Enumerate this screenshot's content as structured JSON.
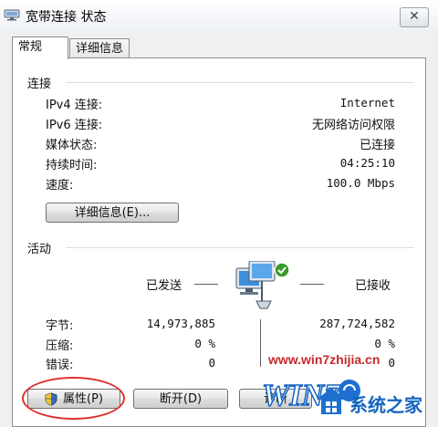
{
  "window": {
    "title": "宽带连接 状态",
    "close_glyph": "✕"
  },
  "tabs": [
    {
      "label": "常规",
      "active": true
    },
    {
      "label": "详细信息",
      "active": false
    }
  ],
  "connection": {
    "section_title": "连接",
    "rows": [
      {
        "label": "IPv4 连接:",
        "value": "Internet"
      },
      {
        "label": "IPv6 连接:",
        "value": "无网络访问权限"
      },
      {
        "label": "媒体状态:",
        "value": "已连接"
      },
      {
        "label": "持续时间:",
        "value": "04:25:10"
      },
      {
        "label": "速度:",
        "value": "100.0 Mbps"
      }
    ],
    "details_button": "详细信息(E)..."
  },
  "activity": {
    "section_title": "活动",
    "sent_label": "已发送",
    "received_label": "已接收",
    "rows": [
      {
        "label": "字节:",
        "sent": "14,973,885",
        "received": "287,724,582"
      },
      {
        "label": "压缩:",
        "sent": "0 %",
        "received": "0 %"
      },
      {
        "label": "错误:",
        "sent": "0",
        "received": "0"
      }
    ]
  },
  "buttons": {
    "properties": "属性(P)",
    "disconnect": "断开(D)",
    "diagnose": "诊断"
  },
  "watermark": {
    "url": "www.win7zhijia.cn",
    "brand": "系统之家",
    "logo_text": "WIN7"
  },
  "colors": {
    "highlight_ellipse": "#e0302c",
    "watermark_url": "#c8282a",
    "watermark_blue": "#1565c0",
    "check_green": "#3a9a2a"
  }
}
